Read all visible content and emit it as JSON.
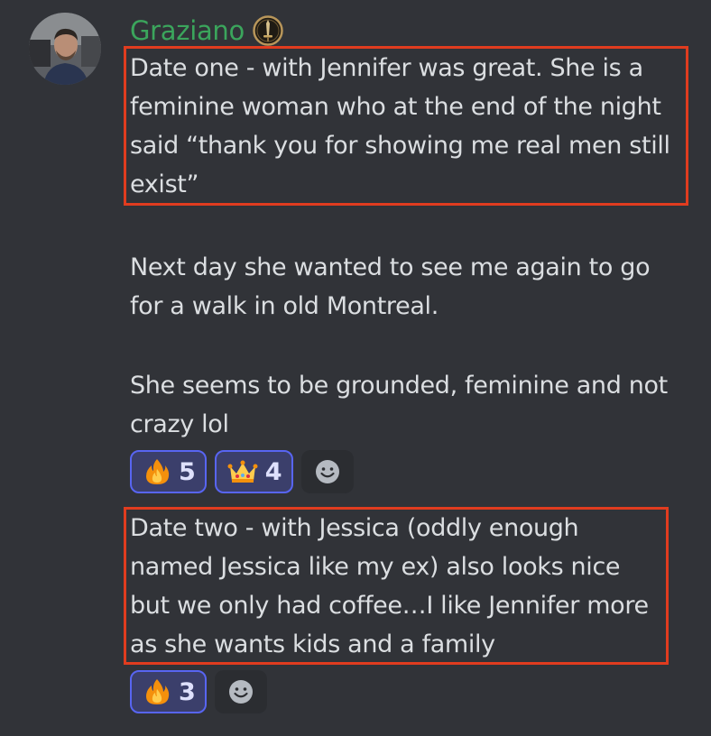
{
  "message": {
    "author": "Graziano",
    "author_color": "#3ba55c",
    "avatar_icon": "user-photo-avatar",
    "role_icon": "sword-badge-icon",
    "highlight_color": "#e03c1f",
    "paragraph1": "Date one - with Jennifer was great. She is a\nfeminine woman who at the end of the night\nsaid “thank you for showing me real men still\nexist”",
    "paragraph2": "Next day she wanted to see me again to go\nfor a walk in old Montreal.",
    "paragraph3": "She seems to be grounded, feminine and not\ncrazy lol",
    "reactions": [
      {
        "emoji": "fire-emoji",
        "count": "5"
      },
      {
        "emoji": "crown-emoji",
        "count": "4"
      }
    ],
    "add_reaction_icon": "smiley-add-reaction-icon"
  },
  "followup": {
    "text": "Date two - with Jessica (oddly enough\nnamed Jessica like my ex) also looks nice\nbut we only had coffee…I like Jennifer more\nas she wants kids and a family",
    "reactions": [
      {
        "emoji": "fire-emoji",
        "count": "3"
      }
    ],
    "add_reaction_icon": "smiley-add-reaction-icon"
  }
}
